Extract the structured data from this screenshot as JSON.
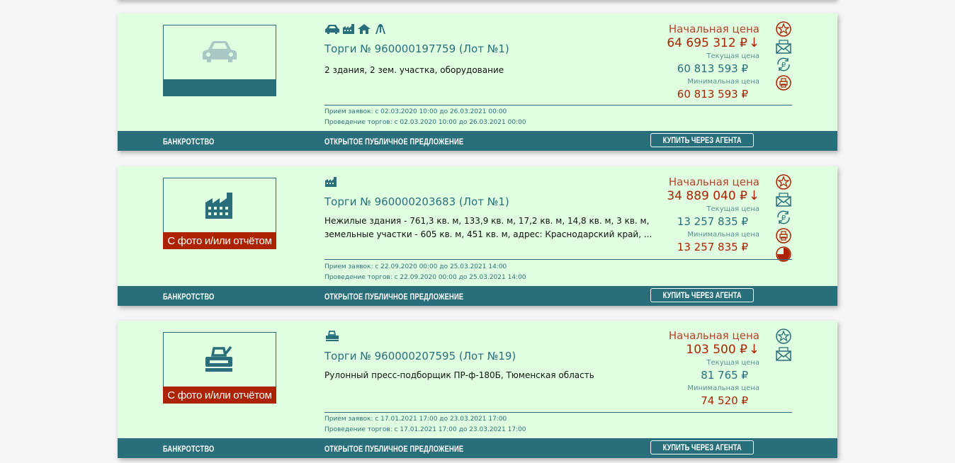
{
  "colors": {
    "accent": "#286f7b",
    "price_red": "#ad2200",
    "card_bg": "#e0ffe0"
  },
  "lots": [
    {
      "title": "Торги № 960000197759 (Лот №1)",
      "description": "2 здания, 2 зем. участка, оборудование",
      "category_icons": [
        "car-icon",
        "factory-icon",
        "house-icon",
        "tools-icon"
      ],
      "thumb_icon": "car-icon",
      "thumb_badge": "",
      "start_label": "Начальная цена",
      "start_price": "64 695 312 ₽",
      "arrow": "↓",
      "current_label": "Текущая цена",
      "current_price": "60 813 593 ₽",
      "min_label": "Минимальная цена",
      "min_price": "60 813 593 ₽",
      "dates_apply": "Прием заявок: с 02.03.2020 10:00 до 26.03.2021 00:00",
      "dates_trade": "Проведение торгов: с 02.03.2020 10:00 до 26.03.2021 00:00",
      "side_icons": [
        "star-icon",
        "envelope-icon",
        "ruble-cycle-icon",
        "printer-icon"
      ],
      "type": "БАНКРОТСТВО",
      "procedure": "ОТКРЫТОЕ ПУБЛИЧНОЕ ПРЕДЛОЖЕНИЕ",
      "agent_button": "КУПИТЬ ЧЕРЕЗ АГЕНТА"
    },
    {
      "title": "Торги № 960000203683 (Лот №1)",
      "description": "Нежилые здания - 761,3 кв. м, 133,9 кв. м, 17,2 кв. м, 14,8 кв. м, 3 кв. м, земельные участки - 605 кв. м, 451 кв. м, адрес: Краснодарский край, ...",
      "category_icons": [
        "factory-icon"
      ],
      "thumb_icon": "factory-icon",
      "thumb_badge": "С фото и/или отчётом",
      "start_label": "Начальная цена",
      "start_price": "34 889 040 ₽",
      "arrow": "↓",
      "current_label": "Текущая цена",
      "current_price": "13 257 835 ₽",
      "min_label": "Минимальная цена",
      "min_price": "13 257 835 ₽",
      "dates_apply": "Прием заявок: с 22.09.2020 00:00 до 25.03.2021 14:00",
      "dates_trade": "Проведение торгов: с 22.09.2020 00:00 до 25.03.2021 14:00",
      "side_icons": [
        "star-icon",
        "envelope-icon",
        "ruble-cycle-icon",
        "printer-icon",
        "pie-chart-icon"
      ],
      "type": "БАНКРОТСТВО",
      "procedure": "ОТКРЫТОЕ ПУБЛИЧНОЕ ПРЕДЛОЖЕНИЕ",
      "agent_button": "КУПИТЬ ЧЕРЕЗ АГЕНТА"
    },
    {
      "title": "Торги № 960000207595 (Лот №19)",
      "description": "Рулонный пресс-подборщик ПР-ф-180Б, Тюменская область",
      "category_icons": [
        "machine-icon"
      ],
      "thumb_icon": "machine-icon",
      "thumb_badge": "С фото и/или отчётом",
      "start_label": "Начальная цена",
      "start_price": "103 500 ₽",
      "arrow": "↓",
      "current_label": "Текущая цена",
      "current_price": "81 765 ₽",
      "min_label": "Минимальная цена",
      "min_price": "74 520 ₽",
      "dates_apply": "Прием заявок: с 17.01.2021 17:00 до 23.03.2021 17:00",
      "dates_trade": "Проведение торгов: с 17.01.2021 17:00 до 23.03.2021 17:00",
      "side_icons": [
        "star-icon",
        "envelope-icon"
      ],
      "type": "БАНКРОТСТВО",
      "procedure": "ОТКРЫТОЕ ПУБЛИЧНОЕ ПРЕДЛОЖЕНИЕ",
      "agent_button": "КУПИТЬ ЧЕРЕЗ АГЕНТА"
    }
  ]
}
